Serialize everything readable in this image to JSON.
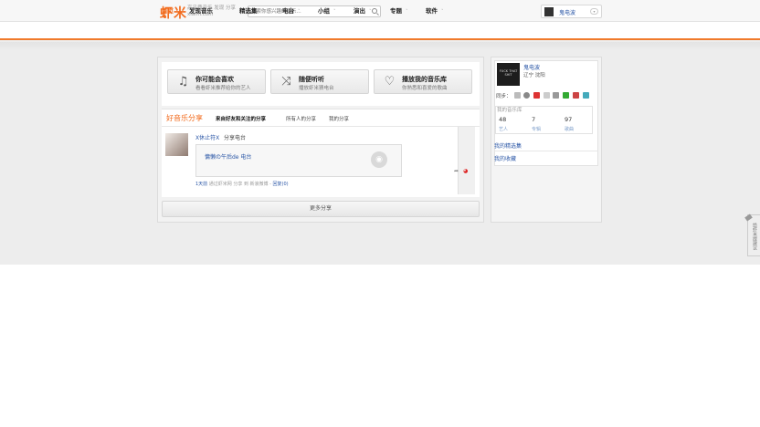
{
  "header": {
    "logo": "虾米",
    "slogan_line1": "高品质音乐 发现 分享",
    "slogan_line2": "xiami.com",
    "search_placeholder": "搜索你感兴趣的音乐...",
    "username": "鬼电波"
  },
  "nav": {
    "items": [
      {
        "label": "首页",
        "active": true
      },
      {
        "label": "发现音乐",
        "arrow": "˅"
      },
      {
        "label": "精选集",
        "arrow": "˅"
      },
      {
        "label": "电台",
        "arrow": "˅"
      },
      {
        "label": "小组",
        "arrow": "˅"
      },
      {
        "label": "演出",
        "arrow": "˅"
      },
      {
        "label": "专题",
        "arrow": "˅"
      },
      {
        "label": "软件",
        "arrow": "˅"
      }
    ]
  },
  "features": [
    {
      "title": "你可能会喜欢",
      "subtitle": "看看虾米推荐给你的艺人",
      "icon": "music-notes-icon"
    },
    {
      "title": "随便听听",
      "subtitle": "播放虾米猜电台",
      "icon": "shuffle-icon"
    },
    {
      "title": "播放我的音乐库",
      "subtitle": "你熟悉和喜爱的歌曲",
      "icon": "heart-icon"
    }
  ],
  "share": {
    "title": "好音乐分享",
    "tabs": [
      "来自好友和关注的分享",
      "所有人的分享",
      "我的分享"
    ],
    "feed": {
      "user": "X休止符X",
      "verb": "分享电台",
      "card_title": "慵懒の午后de 电台",
      "meta_time": "1天前",
      "meta_source": "通过虾米网 分享 到 新浪微博 -",
      "meta_reply": "回复(0)"
    },
    "more_label": "更多分享"
  },
  "sidebar": {
    "avatar_text": "FUCK THAT SHIT",
    "name": "鬼电波",
    "location": "辽宁 沈阳",
    "sync_label": "同步：",
    "library_title": "我的音乐库",
    "stats": [
      {
        "value": "48",
        "label": "艺人"
      },
      {
        "value": "7",
        "label": "专辑"
      },
      {
        "value": "97",
        "label": "歌曲"
      }
    ],
    "links": [
      "我的精选集",
      "我的收藏"
    ]
  },
  "feedback_label": "给虾米提建议",
  "colors": {
    "accent": "#f26b1d",
    "link": "#2a56a6"
  }
}
